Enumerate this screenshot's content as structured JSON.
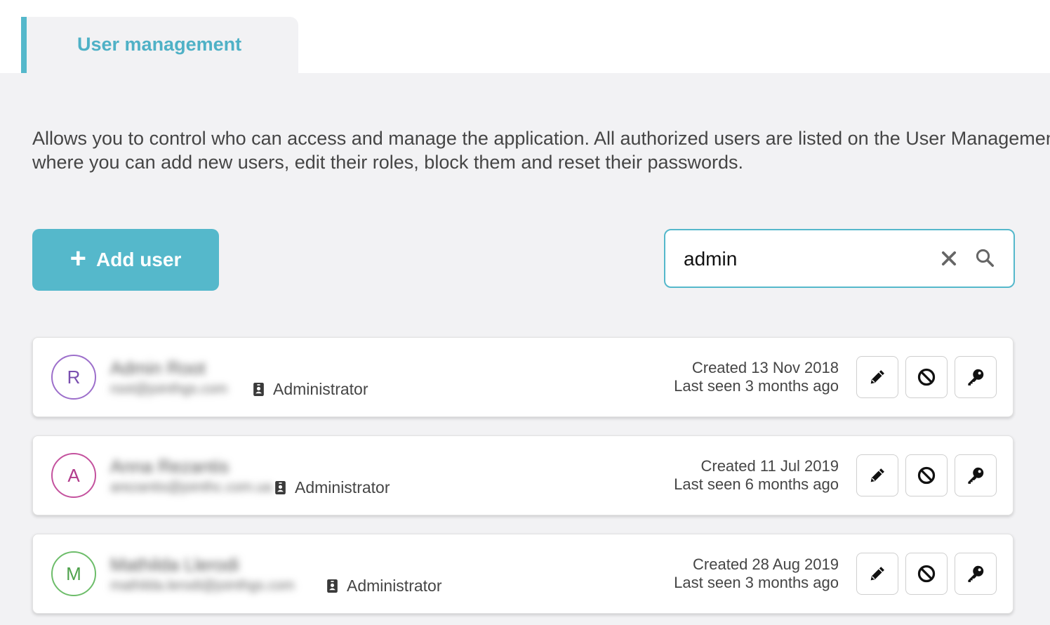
{
  "tab": {
    "label": "User management"
  },
  "description": "Allows you to control who can access and manage the application. All authorized users are listed on the User Management page, where you can add new users, edit their roles, block them and reset their passwords.",
  "toolbar": {
    "add_label": "Add user",
    "search_value": "admin",
    "search_icons": [
      "close-icon",
      "search-icon"
    ]
  },
  "colors": {
    "accent": "#55b8cb"
  },
  "users": [
    {
      "initial": "R",
      "avatar_color": "#9d6fcb",
      "name": "Admin Root",
      "email": "root@jointhgs.com",
      "role": "Administrator",
      "created": "Created 13 Nov 2018",
      "last_seen": "Last seen 3 months ago"
    },
    {
      "initial": "A",
      "avatar_color": "#c4529e",
      "name": "Anna Rezantis",
      "email": "arezantis@jointhc.com.ua",
      "role": "Administrator",
      "created": "Created 11 Jul 2019",
      "last_seen": "Last seen 6 months ago"
    },
    {
      "initial": "M",
      "avatar_color": "#6dbd6a",
      "name": "Mathilda Llerodi",
      "email": "mathilda.lerodi@jointhgs.com",
      "role": "Administrator",
      "created": "Created 28 Aug 2019",
      "last_seen": "Last seen 3 months ago"
    }
  ],
  "row_actions": [
    "edit-icon",
    "block-icon",
    "key-icon"
  ]
}
